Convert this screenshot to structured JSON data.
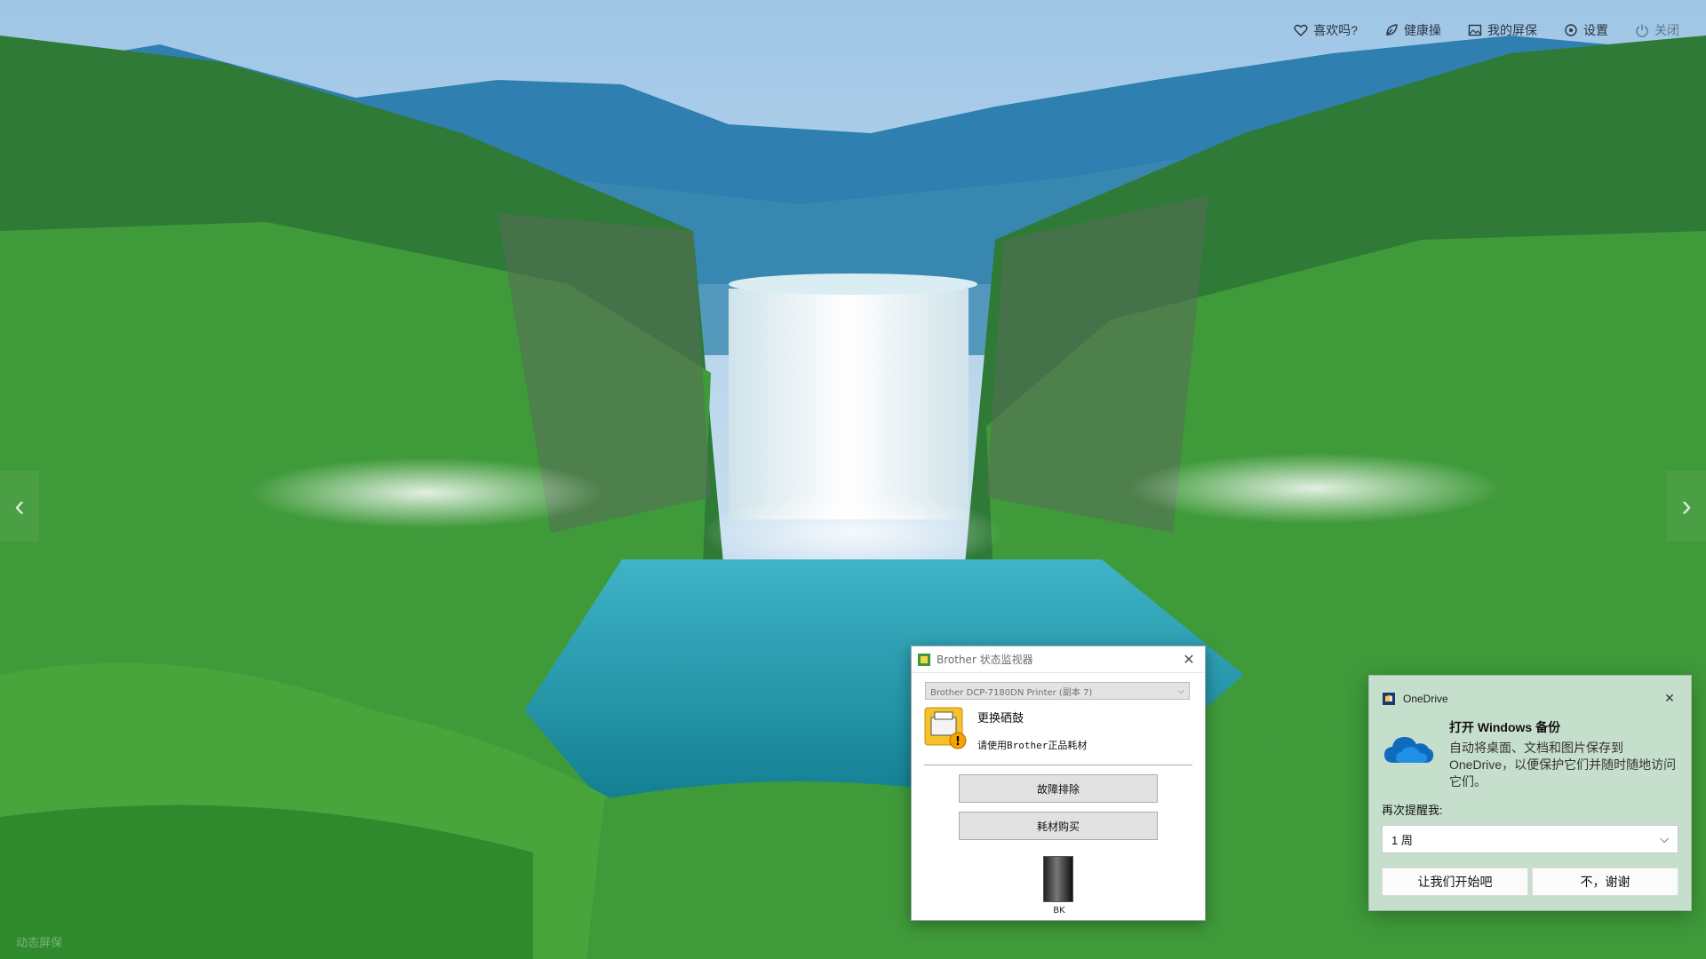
{
  "screensaver": {
    "toolbar": [
      {
        "id": "like",
        "label": "喜欢吗?",
        "icon": "heart-icon"
      },
      {
        "id": "healthy",
        "label": "健康操",
        "icon": "leaf-icon"
      },
      {
        "id": "my-screensaver",
        "label": "我的屏保",
        "icon": "image-icon"
      },
      {
        "id": "settings",
        "label": "设置",
        "icon": "gear-icon"
      },
      {
        "id": "close",
        "label": "关闭",
        "icon": "power-icon"
      }
    ],
    "prev_arrow": "‹",
    "next_arrow": "›",
    "watermark": "动态屏保"
  },
  "brother_monitor": {
    "title": "Brother 状态监视器",
    "printer_select": "Brother DCP-7180DN Printer (副本 7)",
    "status_headline": "更换硒鼓",
    "status_message": "请使用Brother正品耗材",
    "buttons": {
      "troubleshoot": "故障排除",
      "purchase": "耗材购买"
    },
    "toner_label": "BK",
    "toner_level_fraction": 1.0
  },
  "onedrive_toast": {
    "app_name": "OneDrive",
    "heading": "打开 Windows 备份",
    "message": "自动将桌面、文档和图片保存到 OneDrive，以便保护它们并随时随地访问它们。",
    "remind_label": "再次提醒我:",
    "remind_value": "1 周",
    "primary_action": "让我们开始吧",
    "secondary_action": "不，谢谢"
  },
  "colors": {
    "toast_bg": "#cce2d3",
    "onedrive_blue": "#0f6cbd"
  }
}
